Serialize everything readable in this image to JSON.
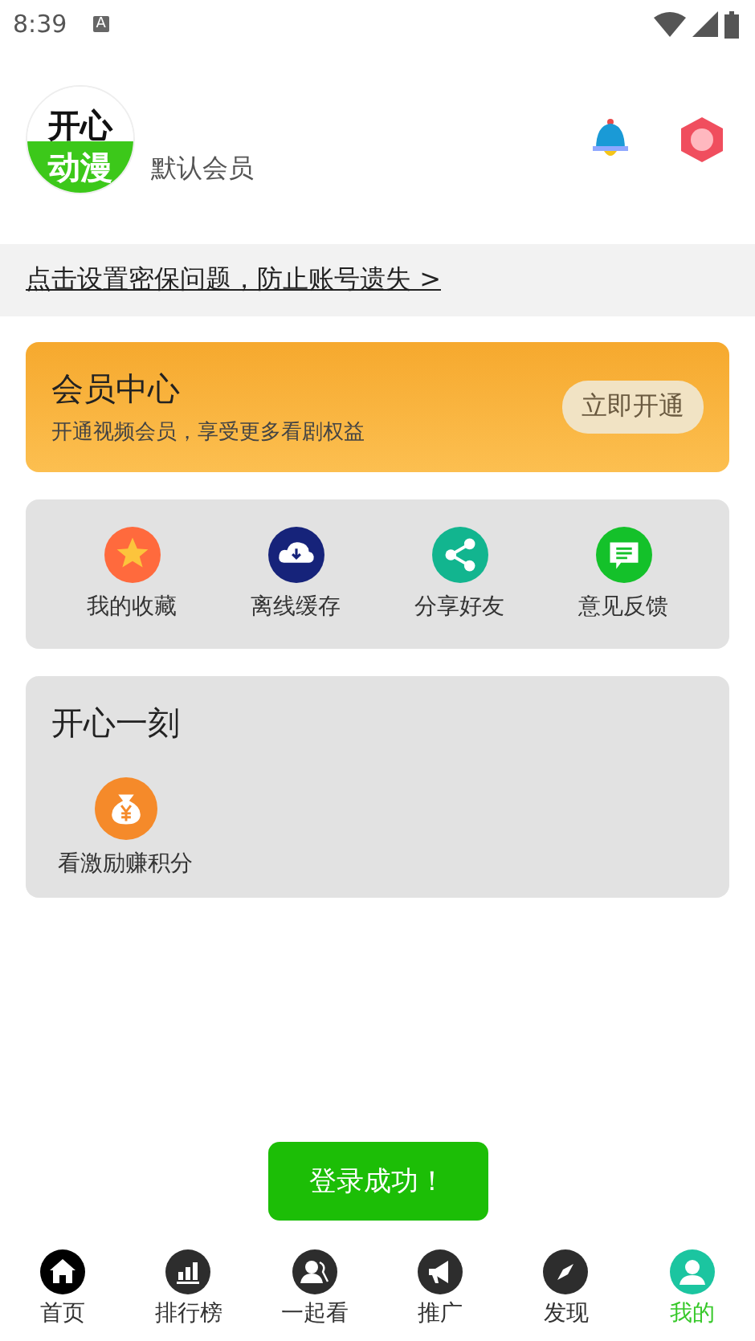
{
  "status_bar": {
    "time": "8:39",
    "notification": "A"
  },
  "profile": {
    "logo_top": "开心",
    "logo_bottom": "动漫",
    "member_level": "默认会员"
  },
  "notice": {
    "text": "点击设置密保问题，防止账号遗失 >"
  },
  "vip_card": {
    "title": "会员中心",
    "subtitle": "开通视频会员，享受更多看剧权益",
    "button": "立即开通"
  },
  "features": [
    {
      "kind": "star",
      "label": "我的收藏",
      "color": "#ff6a3d"
    },
    {
      "kind": "download",
      "label": "离线缓存",
      "color": "#16237a"
    },
    {
      "kind": "share",
      "label": "分享好友",
      "color": "#12b58f"
    },
    {
      "kind": "feedback",
      "label": "意见反馈",
      "color": "#14c12a"
    }
  ],
  "fun_section": {
    "title": "开心一刻",
    "items": [
      {
        "kind": "money",
        "label": "看激励赚积分",
        "color": "#f58a2a"
      }
    ]
  },
  "toast": {
    "text": "登录成功！"
  },
  "tabs": [
    {
      "kind": "home",
      "label": "首页",
      "selected": false
    },
    {
      "kind": "rank",
      "label": "排行榜",
      "selected": false
    },
    {
      "kind": "together",
      "label": "一起看",
      "selected": false
    },
    {
      "kind": "promote",
      "label": "推广",
      "selected": false
    },
    {
      "kind": "discover",
      "label": "发现",
      "selected": false
    },
    {
      "kind": "me",
      "label": "我的",
      "selected": true
    }
  ]
}
